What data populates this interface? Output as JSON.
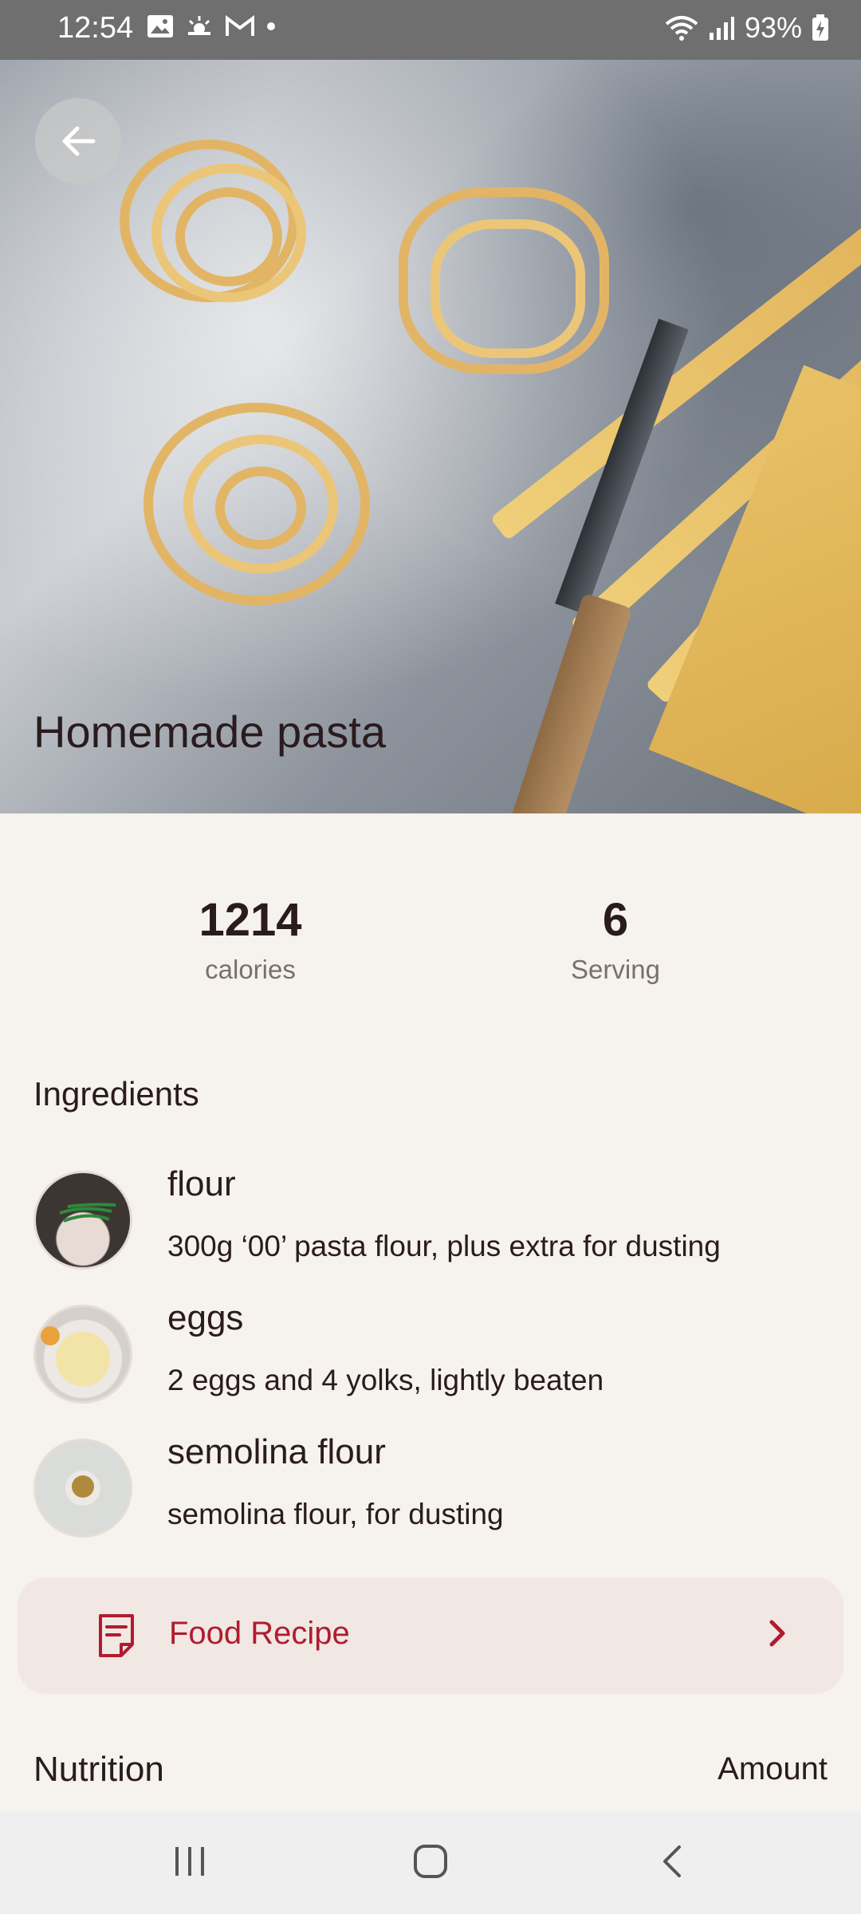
{
  "status_bar": {
    "time": "12:54",
    "battery": "93%",
    "icons_left": [
      "image-icon",
      "weather-icon",
      "gmail-icon",
      "dot-icon"
    ],
    "icons_right": [
      "wifi-icon",
      "signal-icon",
      "battery-icon"
    ]
  },
  "recipe": {
    "title": "Homemade pasta"
  },
  "stats": {
    "calories_value": "1214",
    "calories_label": "calories",
    "serving_value": "6",
    "serving_label": "Serving"
  },
  "ingredients": {
    "title": "Ingredients",
    "items": [
      {
        "name": "flour",
        "description": "300g ‘00’ pasta flour, plus extra for dusting"
      },
      {
        "name": "eggs",
        "description": "2 eggs and 4 yolks, lightly beaten"
      },
      {
        "name": "semolina flour",
        "description": "semolina flour, for dusting"
      }
    ]
  },
  "food_recipe": {
    "label": "Food Recipe",
    "accent": "#b01c2e"
  },
  "nutrition": {
    "title": "Nutrition",
    "amount_label": "Amount"
  },
  "nav": [
    "recent-apps",
    "home",
    "back"
  ]
}
